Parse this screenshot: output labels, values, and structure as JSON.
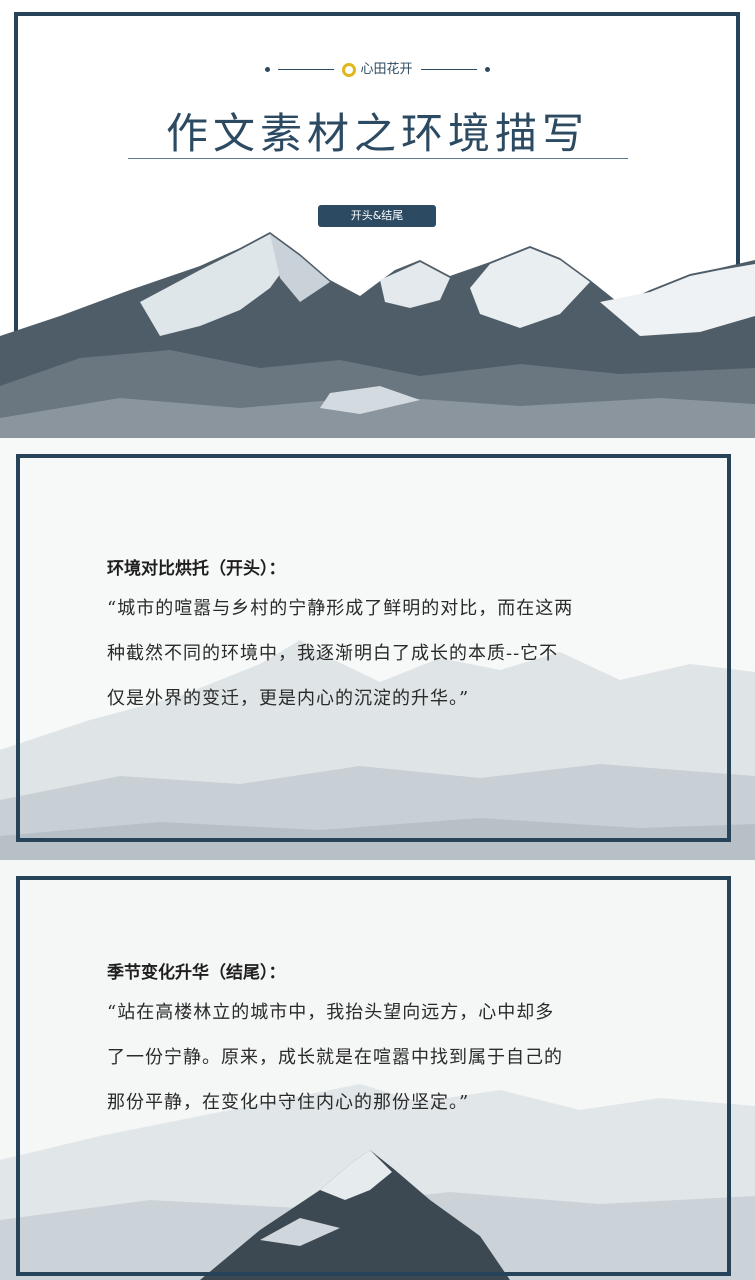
{
  "brand": {
    "name": "心田花开"
  },
  "cover": {
    "title": "作文素材之环境描写",
    "tag": "开头&结尾"
  },
  "sections": [
    {
      "heading": "环境对比烘托（开头）：",
      "lines": [
        "“城市的喧嚣与乡村的宁静形成了鲜明的对比，而在这两",
        "种截然不同的环境中，我逐渐明白了成长的本质--它不",
        "仅是外界的变迁，更是内心的沉淀的升华。”"
      ]
    },
    {
      "heading": "季节变化升华（结尾）：",
      "lines": [
        "“站在高楼林立的城市中，我抬头望向远方，心中却多",
        "了一份宁静。原来，成长就是在喧嚣中找到属于自己的",
        "那份平静，在变化中守住内心的那份坚定。”"
      ]
    }
  ],
  "colors": {
    "frame": "#27435a",
    "accent": "#2c4a62",
    "logo_yellow": "#e2b71c"
  }
}
